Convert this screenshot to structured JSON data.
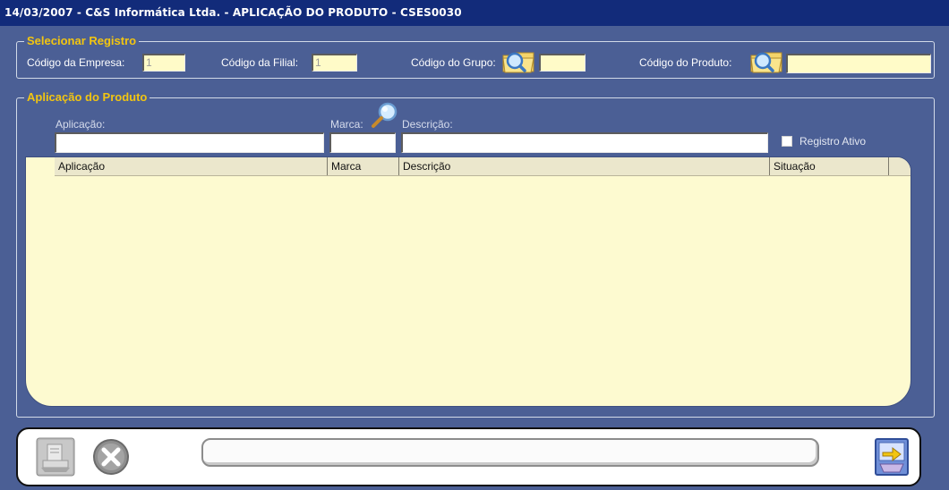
{
  "window": {
    "title": "14/03/2007  -  C&S Informática Ltda.  -  APLICAÇÃO DO PRODUTO  -  CSES0030"
  },
  "select_group": {
    "legend": "Selecionar Registro",
    "empresa": {
      "label": "Código da Empresa:",
      "value": "1"
    },
    "filial": {
      "label": "Código da Filial:",
      "value": "1"
    },
    "grupo": {
      "label": "Código do Grupo:",
      "value": ""
    },
    "produto": {
      "label": "Código do Produto:",
      "value": ""
    }
  },
  "app_group": {
    "legend": "Aplicação do Produto",
    "aplicacao": {
      "label": "Aplicação:",
      "value": ""
    },
    "marca": {
      "label": "Marca:",
      "value": ""
    },
    "descricao": {
      "label": "Descrição:",
      "value": ""
    },
    "registro_ativo": {
      "label": "Registro Ativo",
      "checked": false
    }
  },
  "grid": {
    "columns": [
      "Aplicação",
      "Marca",
      "Descrição",
      "Situação"
    ],
    "rows": []
  },
  "footer": {
    "status_text": ""
  },
  "icons": {
    "folder_search": "folder-search-icon",
    "magnifier": "magnifier-icon",
    "print": "print-icon",
    "cancel": "cancel-icon",
    "exit": "exit-icon"
  },
  "colors": {
    "background": "#4b5f95",
    "titlebar": "#122b7a",
    "legend": "#f2c511",
    "field": "#fffbc8",
    "grid": "#fdfad0"
  }
}
